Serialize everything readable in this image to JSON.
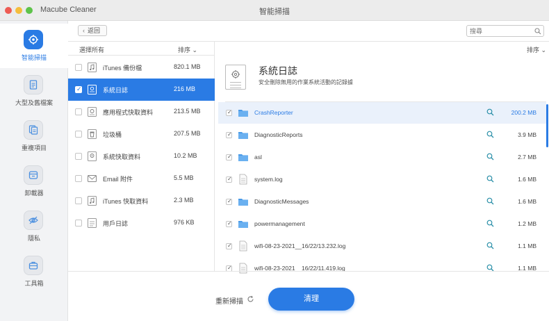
{
  "window": {
    "app_name": "Macube Cleaner",
    "title": "智能掃描"
  },
  "sidebar": {
    "items": [
      {
        "label": "智能掃描",
        "icon": "target-icon",
        "active": true
      },
      {
        "label": "大型及舊檔案",
        "icon": "document-icon",
        "active": false
      },
      {
        "label": "重複項目",
        "icon": "duplicate-icon",
        "active": false
      },
      {
        "label": "卸載器",
        "icon": "uninstaller-icon",
        "active": false
      },
      {
        "label": "隱私",
        "icon": "eye-slash-icon",
        "active": false
      },
      {
        "label": "工具箱",
        "icon": "toolbox-icon",
        "active": false
      }
    ]
  },
  "header": {
    "back_label": "返回",
    "search_placeholder": "搜尋"
  },
  "categories": {
    "select_all": "選擇所有",
    "sort_label": "排序",
    "items": [
      {
        "name": "iTunes 備份檔",
        "size": "820.1 MB",
        "selected": false
      },
      {
        "name": "系統日誌",
        "size": "216 MB",
        "selected": true
      },
      {
        "name": "應用程式快取資料",
        "size": "213.5 MB",
        "selected": false
      },
      {
        "name": "垃圾桶",
        "size": "207.5 MB",
        "selected": false
      },
      {
        "name": "系統快取資料",
        "size": "10.2 MB",
        "selected": false
      },
      {
        "name": "Email 附件",
        "size": "5.5 MB",
        "selected": false
      },
      {
        "name": "iTunes 快取資料",
        "size": "2.3 MB",
        "selected": false
      },
      {
        "name": "用戶日誌",
        "size": "976 KB",
        "selected": false
      }
    ]
  },
  "detail": {
    "sort_label": "排序",
    "title": "系統日誌",
    "description": "安全刪除無用的作業系統活動的記錄據",
    "files": [
      {
        "name": "CrashReporter",
        "size": "200.2 MB",
        "type": "folder",
        "checked": true,
        "highlight": true
      },
      {
        "name": "DiagnosticReports",
        "size": "3.9 MB",
        "type": "folder",
        "checked": true,
        "highlight": false
      },
      {
        "name": "asl",
        "size": "2.7 MB",
        "type": "folder",
        "checked": true,
        "highlight": false
      },
      {
        "name": "system.log",
        "size": "1.6 MB",
        "type": "file",
        "checked": true,
        "highlight": false
      },
      {
        "name": "DiagnosticMessages",
        "size": "1.6 MB",
        "type": "folder",
        "checked": true,
        "highlight": false
      },
      {
        "name": "powermanagement",
        "size": "1.2 MB",
        "type": "folder",
        "checked": true,
        "highlight": false
      },
      {
        "name": "wifi-08-23-2021__16/22/13.232.log",
        "size": "1.1 MB",
        "type": "file",
        "checked": true,
        "highlight": false
      },
      {
        "name": "wifi-08-23-2021__16/22/11.419.log",
        "size": "1.1 MB",
        "type": "file",
        "checked": true,
        "highlight": false
      }
    ]
  },
  "footer": {
    "rescan_label": "重新掃描",
    "clean_label": "清理"
  },
  "colors": {
    "accent": "#2a7be4",
    "folder": "#4a9be8",
    "sidebar_bg": "#f2f3f5"
  }
}
